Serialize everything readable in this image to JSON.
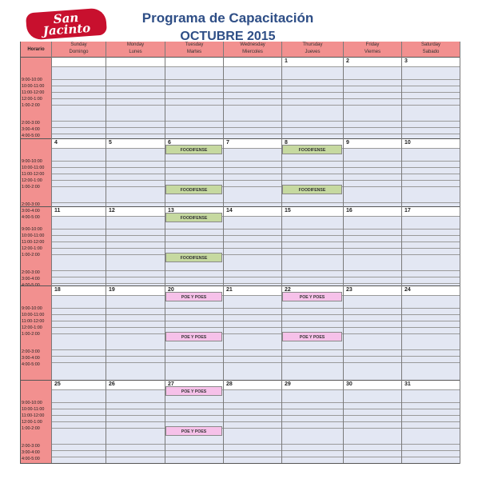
{
  "logo": {
    "line1": "San",
    "line2": "Jacinto"
  },
  "title": "Programa de Capacitación",
  "subtitle": "OCTUBRE 2015",
  "header": {
    "horario": "Horario",
    "days": [
      {
        "en": "Sunday",
        "es": "Domingo"
      },
      {
        "en": "Monday",
        "es": "Lunes"
      },
      {
        "en": "Tuesday",
        "es": "Martes"
      },
      {
        "en": "Wednesday",
        "es": "Miercoles"
      },
      {
        "en": "Thursday",
        "es": "Jueves"
      },
      {
        "en": "Friday",
        "es": "Viernes"
      },
      {
        "en": "Saturday",
        "es": "Sabado"
      }
    ]
  },
  "weeks": [
    {
      "days": [
        "",
        "",
        "",
        "",
        "1",
        "2",
        "3"
      ],
      "times": [
        "9:00-10:00",
        "10:00-11:00",
        "11:00-12:00",
        "12:00-1:00",
        "1:00-2:00",
        "2:00-3:00",
        "3:00-4:00",
        "4:00-5:00"
      ],
      "events": []
    },
    {
      "days": [
        "4",
        "5",
        "6",
        "7",
        "8",
        "9",
        "10"
      ],
      "times": [
        "9:00-10:00",
        "10:00-11:00",
        "11:00-12:00",
        "12:00-1:00",
        "1:00-2:00",
        "2:00-3:00",
        "3:00-4:00",
        "4:00-5:00"
      ],
      "events": [
        {
          "label": "FOODIFENSE",
          "kind": "food",
          "day": 2,
          "slot": "am"
        },
        {
          "label": "FOODIFENSE",
          "kind": "food",
          "day": 4,
          "slot": "am"
        },
        {
          "label": "FOODIFENSE",
          "kind": "food",
          "day": 2,
          "slot": "pm"
        },
        {
          "label": "FOODIFENSE",
          "kind": "food",
          "day": 4,
          "slot": "pm"
        }
      ]
    },
    {
      "days": [
        "11",
        "12",
        "13",
        "14",
        "15",
        "16",
        "17"
      ],
      "times": [
        "9:00-10:00",
        "10:00-11:00",
        "11:00-12:00",
        "12:00-1:00",
        "1:00-2:00",
        "2:00-3:00",
        "3:00-4:00",
        "4:00-5:00"
      ],
      "events": [
        {
          "label": "FOODIFENSE",
          "kind": "food",
          "day": 2,
          "slot": "am"
        },
        {
          "label": "FOODIFENSE",
          "kind": "food",
          "day": 2,
          "slot": "pm"
        }
      ]
    },
    {
      "days": [
        "18",
        "19",
        "20",
        "21",
        "22",
        "23",
        "24"
      ],
      "times": [
        "9:00-10:00",
        "10:00-11:00",
        "11:00-12:00",
        "12:00-1:00",
        "1:00-2:00",
        "2:00-3:00",
        "3:00-4:00",
        "4:00-5:00"
      ],
      "events": [
        {
          "label": "POE Y POES",
          "kind": "poe",
          "day": 2,
          "slot": "am"
        },
        {
          "label": "POE Y POES",
          "kind": "poe",
          "day": 4,
          "slot": "am"
        },
        {
          "label": "POE Y POES",
          "kind": "poe",
          "day": 2,
          "slot": "pm"
        },
        {
          "label": "POE Y POES",
          "kind": "poe",
          "day": 4,
          "slot": "pm"
        }
      ]
    },
    {
      "days": [
        "25",
        "26",
        "27",
        "28",
        "29",
        "30",
        "31"
      ],
      "times": [
        "9:00-10:00",
        "10:00-11:00",
        "11:00-12:00",
        "12:00-1:00",
        "1:00-2:00",
        "2:00-3:00",
        "3:00-4:00",
        "4:00-5:00"
      ],
      "events": [
        {
          "label": "POE Y POES",
          "kind": "poe",
          "day": 2,
          "slot": "am"
        },
        {
          "label": "POE Y POES",
          "kind": "poe",
          "day": 2,
          "slot": "pm"
        }
      ]
    }
  ]
}
